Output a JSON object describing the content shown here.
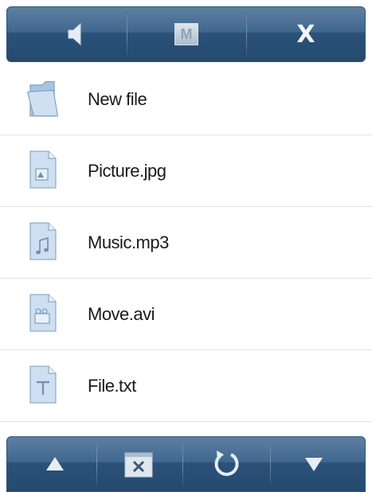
{
  "top_toolbar": {
    "buttons": [
      {
        "icon": "speaker-icon",
        "label": ""
      },
      {
        "icon": "menu-m-icon",
        "label": "M"
      },
      {
        "icon": "close-icon",
        "label": "X"
      }
    ]
  },
  "files": [
    {
      "name": "New file",
      "icon": "folder-icon"
    },
    {
      "name": "Picture.jpg",
      "icon": "image-file-icon"
    },
    {
      "name": "Music.mp3",
      "icon": "music-file-icon"
    },
    {
      "name": "Move.avi",
      "icon": "video-file-icon"
    },
    {
      "name": "File.txt",
      "icon": "text-file-icon"
    }
  ],
  "bottom_toolbar": {
    "buttons": [
      {
        "icon": "arrow-up-icon"
      },
      {
        "icon": "delete-file-icon"
      },
      {
        "icon": "refresh-icon"
      },
      {
        "icon": "arrow-down-icon"
      }
    ]
  },
  "colors": {
    "bar_top": "#5f7fa1",
    "bar_bottom": "#244a70",
    "icon_fill": "#cddff0",
    "icon_stroke": "#7b9cbd"
  }
}
